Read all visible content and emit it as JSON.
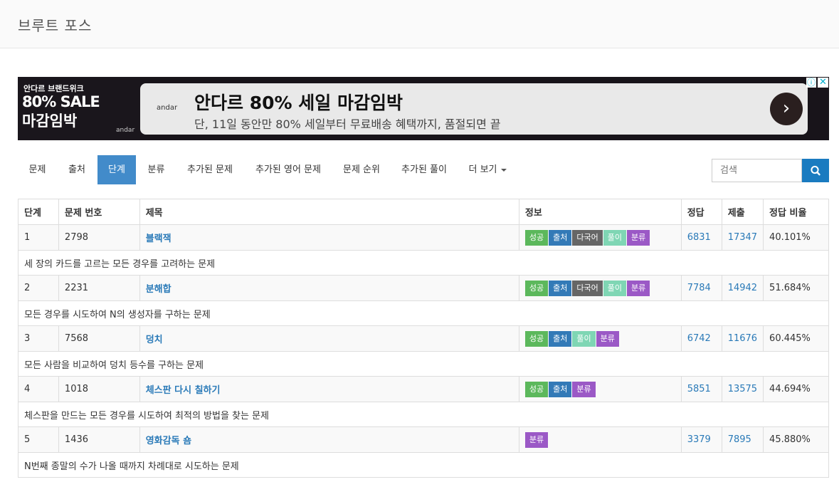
{
  "header": {
    "title": "브루트 포스"
  },
  "ad": {
    "left_line1": "안다르 브랜드위크",
    "left_line2": "80% SALE",
    "left_line3": "마감임박",
    "left_brand": "andar",
    "card_brand": "andar",
    "headline": "안다르 80% 세일 마감임박",
    "subline": "단, 11일 동안만 80% 세일부터 무료배송 혜택까지, 품절되면 끝",
    "arrow_icon": "chevron-right-icon",
    "info_icon": "info-icon",
    "close_icon": "close-icon"
  },
  "nav": {
    "tabs": [
      {
        "label": "문제",
        "active": false
      },
      {
        "label": "출처",
        "active": false
      },
      {
        "label": "단계",
        "active": true
      },
      {
        "label": "분류",
        "active": false
      },
      {
        "label": "추가된 문제",
        "active": false
      },
      {
        "label": "추가된 영어 문제",
        "active": false
      },
      {
        "label": "문제 순위",
        "active": false
      },
      {
        "label": "추가된 풀이",
        "active": false
      },
      {
        "label": "더 보기",
        "active": false
      }
    ]
  },
  "search": {
    "placeholder": "검색",
    "value": "",
    "button_icon": "search-icon"
  },
  "colors": {
    "accent": "#428bca",
    "link": "#2a7ab8",
    "success": "#5cb85c",
    "source": "#337ab7",
    "multi": "#666666",
    "solution": "#7fd6b4",
    "category": "#9b59c6"
  },
  "table": {
    "headers": [
      "단계",
      "문제 번호",
      "제목",
      "정보",
      "정답",
      "제출",
      "정답 비율"
    ],
    "rows": [
      {
        "step": "1",
        "id": "2798",
        "title": "블랙잭",
        "badges": [
          "성공",
          "출처",
          "다국어",
          "풀이",
          "분류"
        ],
        "accepted": "6831",
        "submitted": "17347",
        "ratio": "40.101%",
        "desc": "세 장의 카드를 고르는 모든 경우를 고려하는 문제"
      },
      {
        "step": "2",
        "id": "2231",
        "title": "분해합",
        "badges": [
          "성공",
          "출처",
          "다국어",
          "풀이",
          "분류"
        ],
        "accepted": "7784",
        "submitted": "14942",
        "ratio": "51.684%",
        "desc": "모든 경우를 시도하여 N의 생성자를 구하는 문제"
      },
      {
        "step": "3",
        "id": "7568",
        "title": "덩치",
        "badges": [
          "성공",
          "출처",
          "풀이",
          "분류"
        ],
        "accepted": "6742",
        "submitted": "11676",
        "ratio": "60.445%",
        "desc": "모든 사람을 비교하여 덩치 등수를 구하는 문제"
      },
      {
        "step": "4",
        "id": "1018",
        "title": "체스판 다시 칠하기",
        "badges": [
          "성공",
          "출처",
          "분류"
        ],
        "accepted": "5851",
        "submitted": "13575",
        "ratio": "44.694%",
        "desc": "체스판을 만드는 모든 경우를 시도하여 최적의 방법을 찾는 문제"
      },
      {
        "step": "5",
        "id": "1436",
        "title": "영화감독 숌",
        "badges": [
          "분류"
        ],
        "accepted": "3379",
        "submitted": "7895",
        "ratio": "45.880%",
        "desc": "N번째 종말의 수가 나올 때까지 차례대로 시도하는 문제"
      }
    ]
  }
}
